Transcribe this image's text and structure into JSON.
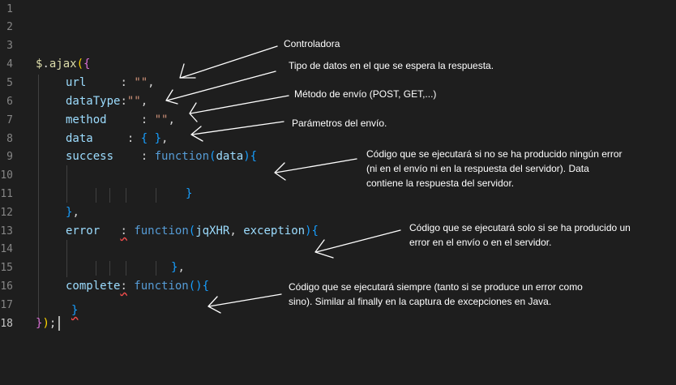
{
  "colors": {
    "background": "#1e1e1e",
    "line_number": "#858585",
    "yellow_func": "#dcdcaa",
    "gold_bracket": "#ffd700",
    "pink_bracket": "#da70d6",
    "blue_bracket": "#179fff",
    "variable": "#9cdcfe",
    "string": "#ce9178",
    "keyword": "#569cd6",
    "plain": "#d4d4d4",
    "annotation_text": "#ffffff"
  },
  "line_numbers": [
    "1",
    "2",
    "3",
    "4",
    "5",
    "6",
    "7",
    "8",
    "9",
    "10",
    "11",
    "12",
    "13",
    "14",
    "15",
    "16",
    "17",
    "18"
  ],
  "code": {
    "l4": {
      "dollar": "$",
      "dot": ".",
      "fn": "ajax",
      "paren": "(",
      "brace": "{"
    },
    "l5": {
      "key": "url",
      "colon": "     : ",
      "str": "\"\"",
      "comma": ","
    },
    "l6": {
      "key": "dataType",
      "colon": ":",
      "str": "\"\"",
      "comma": ","
    },
    "l7": {
      "key": "method",
      "colon": "     : ",
      "str": "\"\"",
      "comma": ","
    },
    "l8": {
      "key": "data",
      "colon": "     : ",
      "obj": "{ }",
      "comma": ","
    },
    "l9": {
      "key": "success",
      "colon": "    : ",
      "kw": "function",
      "paren": "(",
      "param": "data",
      "close": ")",
      "brace": "{"
    },
    "l11": {
      "brace": "}"
    },
    "l12": {
      "brace": "}",
      "comma": ","
    },
    "l13": {
      "key": "error",
      "gap": "   ",
      "colon": ":",
      "kw": " function",
      "paren": "(",
      "p1": "jqXHR",
      "sep": ", ",
      "p2": "exception",
      "close": ")",
      "brace": "{"
    },
    "l15": {
      "brace": "}",
      "comma": ","
    },
    "l16": {
      "key": "complete",
      "colon": ":",
      "kw": " function",
      "paren": "()",
      "brace": "{"
    },
    "l17": {
      "brace": "}"
    },
    "l18": {
      "brace": "}",
      "paren": ")",
      "semi": ";"
    }
  },
  "annotations": {
    "a1": "Controladora",
    "a2": "Tipo de datos en el que se espera la respuesta.",
    "a3": "Método de envío (POST, GET,...)",
    "a4": "Parámetros del envío.",
    "a5_1": "Código que se ejecutará si no se ha producido ningún error",
    "a5_2": "(ni en el envío ni en la respuesta del servidor). Data",
    "a5_3": "contiene la respuesta del servidor.",
    "a6_1": "Código que se ejecutará solo si se ha producido un",
    "a6_2": "error en el envío o en el servidor.",
    "a7_1": "Código que se ejecutará siempre (tanto si se produce un error como",
    "a7_2": "sino). Similar al finally en la captura de excepciones en Java."
  }
}
